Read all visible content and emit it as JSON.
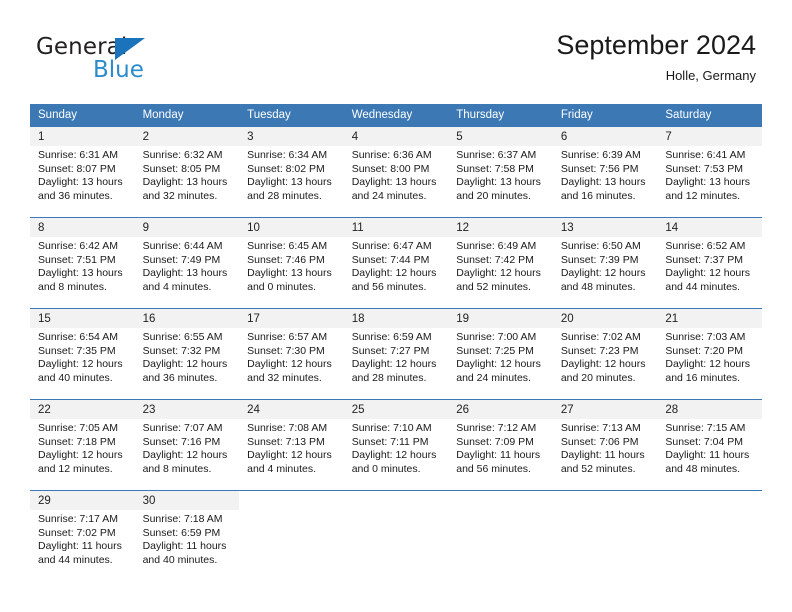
{
  "brand": {
    "name_top": "General",
    "name_bottom": "Blue",
    "triangle_color": "#1b74bb",
    "blue_text_color": "#2b8ccc"
  },
  "header": {
    "title": "September 2024",
    "subtitle": "Holle, Germany"
  },
  "theme": {
    "header_row_bg": "#3b78b4",
    "daynum_band_bg": "#f2f2f2",
    "grid_line": "#3b78b4",
    "text": "#1a1a1a"
  },
  "weekday_headers": [
    "Sunday",
    "Monday",
    "Tuesday",
    "Wednesday",
    "Thursday",
    "Friday",
    "Saturday"
  ],
  "labels": {
    "sunrise_prefix": "Sunrise:",
    "sunset_prefix": "Sunset:",
    "daylight_prefix": "Daylight:"
  },
  "weeks": [
    [
      {
        "day": "1",
        "sunrise": "Sunrise: 6:31 AM",
        "sunset": "Sunset: 8:07 PM",
        "daylight_line1": "Daylight: 13 hours",
        "daylight_line2": "and 36 minutes."
      },
      {
        "day": "2",
        "sunrise": "Sunrise: 6:32 AM",
        "sunset": "Sunset: 8:05 PM",
        "daylight_line1": "Daylight: 13 hours",
        "daylight_line2": "and 32 minutes."
      },
      {
        "day": "3",
        "sunrise": "Sunrise: 6:34 AM",
        "sunset": "Sunset: 8:02 PM",
        "daylight_line1": "Daylight: 13 hours",
        "daylight_line2": "and 28 minutes."
      },
      {
        "day": "4",
        "sunrise": "Sunrise: 6:36 AM",
        "sunset": "Sunset: 8:00 PM",
        "daylight_line1": "Daylight: 13 hours",
        "daylight_line2": "and 24 minutes."
      },
      {
        "day": "5",
        "sunrise": "Sunrise: 6:37 AM",
        "sunset": "Sunset: 7:58 PM",
        "daylight_line1": "Daylight: 13 hours",
        "daylight_line2": "and 20 minutes."
      },
      {
        "day": "6",
        "sunrise": "Sunrise: 6:39 AM",
        "sunset": "Sunset: 7:56 PM",
        "daylight_line1": "Daylight: 13 hours",
        "daylight_line2": "and 16 minutes."
      },
      {
        "day": "7",
        "sunrise": "Sunrise: 6:41 AM",
        "sunset": "Sunset: 7:53 PM",
        "daylight_line1": "Daylight: 13 hours",
        "daylight_line2": "and 12 minutes."
      }
    ],
    [
      {
        "day": "8",
        "sunrise": "Sunrise: 6:42 AM",
        "sunset": "Sunset: 7:51 PM",
        "daylight_line1": "Daylight: 13 hours",
        "daylight_line2": "and 8 minutes."
      },
      {
        "day": "9",
        "sunrise": "Sunrise: 6:44 AM",
        "sunset": "Sunset: 7:49 PM",
        "daylight_line1": "Daylight: 13 hours",
        "daylight_line2": "and 4 minutes."
      },
      {
        "day": "10",
        "sunrise": "Sunrise: 6:45 AM",
        "sunset": "Sunset: 7:46 PM",
        "daylight_line1": "Daylight: 13 hours",
        "daylight_line2": "and 0 minutes."
      },
      {
        "day": "11",
        "sunrise": "Sunrise: 6:47 AM",
        "sunset": "Sunset: 7:44 PM",
        "daylight_line1": "Daylight: 12 hours",
        "daylight_line2": "and 56 minutes."
      },
      {
        "day": "12",
        "sunrise": "Sunrise: 6:49 AM",
        "sunset": "Sunset: 7:42 PM",
        "daylight_line1": "Daylight: 12 hours",
        "daylight_line2": "and 52 minutes."
      },
      {
        "day": "13",
        "sunrise": "Sunrise: 6:50 AM",
        "sunset": "Sunset: 7:39 PM",
        "daylight_line1": "Daylight: 12 hours",
        "daylight_line2": "and 48 minutes."
      },
      {
        "day": "14",
        "sunrise": "Sunrise: 6:52 AM",
        "sunset": "Sunset: 7:37 PM",
        "daylight_line1": "Daylight: 12 hours",
        "daylight_line2": "and 44 minutes."
      }
    ],
    [
      {
        "day": "15",
        "sunrise": "Sunrise: 6:54 AM",
        "sunset": "Sunset: 7:35 PM",
        "daylight_line1": "Daylight: 12 hours",
        "daylight_line2": "and 40 minutes."
      },
      {
        "day": "16",
        "sunrise": "Sunrise: 6:55 AM",
        "sunset": "Sunset: 7:32 PM",
        "daylight_line1": "Daylight: 12 hours",
        "daylight_line2": "and 36 minutes."
      },
      {
        "day": "17",
        "sunrise": "Sunrise: 6:57 AM",
        "sunset": "Sunset: 7:30 PM",
        "daylight_line1": "Daylight: 12 hours",
        "daylight_line2": "and 32 minutes."
      },
      {
        "day": "18",
        "sunrise": "Sunrise: 6:59 AM",
        "sunset": "Sunset: 7:27 PM",
        "daylight_line1": "Daylight: 12 hours",
        "daylight_line2": "and 28 minutes."
      },
      {
        "day": "19",
        "sunrise": "Sunrise: 7:00 AM",
        "sunset": "Sunset: 7:25 PM",
        "daylight_line1": "Daylight: 12 hours",
        "daylight_line2": "and 24 minutes."
      },
      {
        "day": "20",
        "sunrise": "Sunrise: 7:02 AM",
        "sunset": "Sunset: 7:23 PM",
        "daylight_line1": "Daylight: 12 hours",
        "daylight_line2": "and 20 minutes."
      },
      {
        "day": "21",
        "sunrise": "Sunrise: 7:03 AM",
        "sunset": "Sunset: 7:20 PM",
        "daylight_line1": "Daylight: 12 hours",
        "daylight_line2": "and 16 minutes."
      }
    ],
    [
      {
        "day": "22",
        "sunrise": "Sunrise: 7:05 AM",
        "sunset": "Sunset: 7:18 PM",
        "daylight_line1": "Daylight: 12 hours",
        "daylight_line2": "and 12 minutes."
      },
      {
        "day": "23",
        "sunrise": "Sunrise: 7:07 AM",
        "sunset": "Sunset: 7:16 PM",
        "daylight_line1": "Daylight: 12 hours",
        "daylight_line2": "and 8 minutes."
      },
      {
        "day": "24",
        "sunrise": "Sunrise: 7:08 AM",
        "sunset": "Sunset: 7:13 PM",
        "daylight_line1": "Daylight: 12 hours",
        "daylight_line2": "and 4 minutes."
      },
      {
        "day": "25",
        "sunrise": "Sunrise: 7:10 AM",
        "sunset": "Sunset: 7:11 PM",
        "daylight_line1": "Daylight: 12 hours",
        "daylight_line2": "and 0 minutes."
      },
      {
        "day": "26",
        "sunrise": "Sunrise: 7:12 AM",
        "sunset": "Sunset: 7:09 PM",
        "daylight_line1": "Daylight: 11 hours",
        "daylight_line2": "and 56 minutes."
      },
      {
        "day": "27",
        "sunrise": "Sunrise: 7:13 AM",
        "sunset": "Sunset: 7:06 PM",
        "daylight_line1": "Daylight: 11 hours",
        "daylight_line2": "and 52 minutes."
      },
      {
        "day": "28",
        "sunrise": "Sunrise: 7:15 AM",
        "sunset": "Sunset: 7:04 PM",
        "daylight_line1": "Daylight: 11 hours",
        "daylight_line2": "and 48 minutes."
      }
    ],
    [
      {
        "day": "29",
        "sunrise": "Sunrise: 7:17 AM",
        "sunset": "Sunset: 7:02 PM",
        "daylight_line1": "Daylight: 11 hours",
        "daylight_line2": "and 44 minutes."
      },
      {
        "day": "30",
        "sunrise": "Sunrise: 7:18 AM",
        "sunset": "Sunset: 6:59 PM",
        "daylight_line1": "Daylight: 11 hours",
        "daylight_line2": "and 40 minutes."
      },
      {
        "day": "",
        "sunrise": "",
        "sunset": "",
        "daylight_line1": "",
        "daylight_line2": ""
      },
      {
        "day": "",
        "sunrise": "",
        "sunset": "",
        "daylight_line1": "",
        "daylight_line2": ""
      },
      {
        "day": "",
        "sunrise": "",
        "sunset": "",
        "daylight_line1": "",
        "daylight_line2": ""
      },
      {
        "day": "",
        "sunrise": "",
        "sunset": "",
        "daylight_line1": "",
        "daylight_line2": ""
      },
      {
        "day": "",
        "sunrise": "",
        "sunset": "",
        "daylight_line1": "",
        "daylight_line2": ""
      }
    ]
  ]
}
